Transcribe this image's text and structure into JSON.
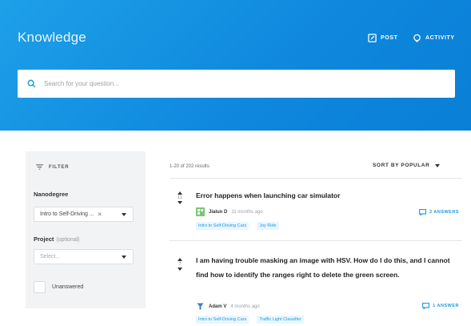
{
  "header": {
    "brand": "Knowledge",
    "post_label": "POST",
    "activity_label": "ACTIVITY",
    "post_icon": "edit-icon",
    "activity_icon": "activity-icon"
  },
  "search": {
    "placeholder": "Search for your question...",
    "value": "",
    "icon": "search-icon"
  },
  "filters": {
    "heading": "FILTER",
    "nanodegree_label": "Nanodegree",
    "nanodegree_value": "Intro to Self-Driving ...",
    "nanodegree_clear": "✕",
    "project_label": "Project",
    "project_optional": "(optional)",
    "project_placeholder": "Select...",
    "unanswered_label": "Unanswered"
  },
  "results": {
    "count_text": "1-20 of 202 results",
    "sort_label": "SORT BY POPULAR"
  },
  "questions": [
    {
      "vote_count": "11",
      "title": "Error happens when launching car simulator",
      "author": "Jialun D",
      "time": "11 months ago",
      "tags": [
        "Intro to Self-Driving Cars",
        "Joy Ride"
      ],
      "answers": "2 ANSWERS"
    },
    {
      "vote_count": "7",
      "title": "I am having trouble masking an image with HSV. How do I do this, and I cannot find how to identify the ranges right to delete the green screen.",
      "author": "Adam V",
      "time": "4 months ago",
      "tags": [
        "Intro to Self-Driving Cars",
        "Traffic Light Classifier"
      ],
      "answers": "1 ANSWER"
    }
  ],
  "colors": {
    "hero": "#0e87dd",
    "accent": "#1a9be0",
    "panel": "#f2f3f5"
  }
}
